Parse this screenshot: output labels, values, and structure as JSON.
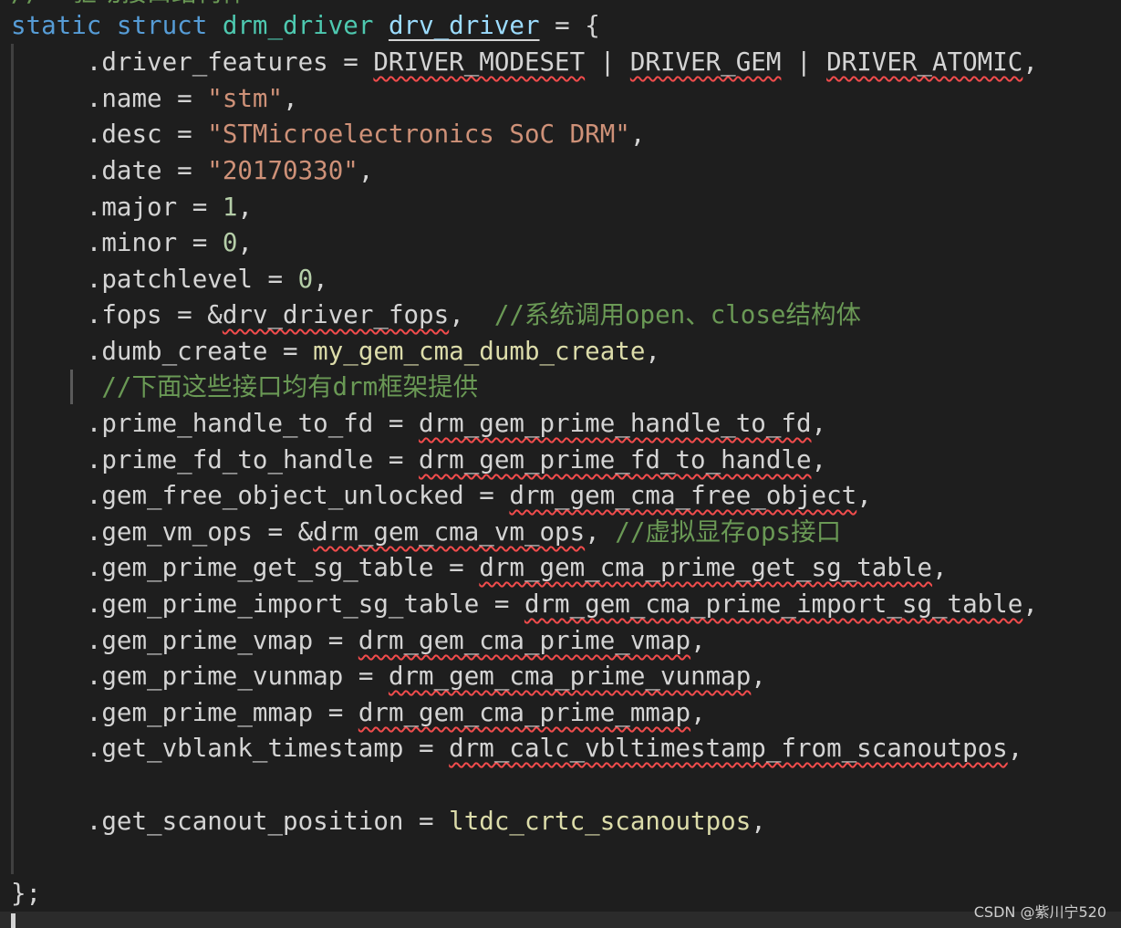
{
  "code": {
    "partial_top_comment": "//  驱动接口结构体",
    "l1": {
      "kw1": "static",
      "kw2": "struct",
      "type": "drm_driver",
      "name": "drv_driver",
      "rest": " = {"
    },
    "l2": {
      "field": ".driver_features",
      "eq": " = ",
      "m1": "DRIVER_MODESET",
      "sep1": " | ",
      "m2": "DRIVER_GEM",
      "sep2": " | ",
      "m3": "DRIVER_ATOMIC",
      "end": ","
    },
    "l3": {
      "field": ".name",
      "eq": " = ",
      "val": "\"stm\"",
      "end": ","
    },
    "l4": {
      "field": ".desc",
      "eq": " = ",
      "val": "\"STMicroelectronics SoC DRM\"",
      "end": ","
    },
    "l5": {
      "field": ".date",
      "eq": " = ",
      "val": "\"20170330\"",
      "end": ","
    },
    "l6": {
      "field": ".major",
      "eq": " = ",
      "val": "1",
      "end": ","
    },
    "l7": {
      "field": ".minor",
      "eq": " = ",
      "val": "0",
      "end": ","
    },
    "l8": {
      "field": ".patchlevel",
      "eq": " = ",
      "val": "0",
      "end": ","
    },
    "l9": {
      "field": ".fops",
      "eq": " = ",
      "amp": "&",
      "val": "drv_driver_fops",
      "end": ",  ",
      "comment": "//系统调用open、close结构体"
    },
    "l10": {
      "field": ".dumb_create",
      "eq": " = ",
      "val": "my_gem_cma_dumb_create",
      "end": ","
    },
    "l11": {
      "comment": "//下面这些接口均有drm框架提供"
    },
    "l12": {
      "field": ".prime_handle_to_fd",
      "eq": " = ",
      "val": "drm_gem_prime_handle_to_fd",
      "end": ","
    },
    "l13": {
      "field": ".prime_fd_to_handle",
      "eq": " = ",
      "val": "drm_gem_prime_fd_to_handle",
      "end": ","
    },
    "l14": {
      "field": ".gem_free_object_unlocked",
      "eq": " = ",
      "val": "drm_gem_cma_free_object",
      "end": ","
    },
    "l15": {
      "field": ".gem_vm_ops",
      "eq": " = ",
      "amp": "&",
      "val": "drm_gem_cma_vm_ops",
      "end": ", ",
      "comment": "//虚拟显存ops接口"
    },
    "l16": {
      "field": ".gem_prime_get_sg_table",
      "eq": " = ",
      "val": "drm_gem_cma_prime_get_sg_table",
      "end": ","
    },
    "l17": {
      "field": ".gem_prime_import_sg_table",
      "eq": " = ",
      "val": "drm_gem_cma_prime_import_sg_table",
      "end": ","
    },
    "l18": {
      "field": ".gem_prime_vmap",
      "eq": " = ",
      "val": "drm_gem_cma_prime_vmap",
      "end": ","
    },
    "l19": {
      "field": ".gem_prime_vunmap",
      "eq": " = ",
      "val": "drm_gem_cma_prime_vunmap",
      "end": ","
    },
    "l20": {
      "field": ".gem_prime_mmap",
      "eq": " = ",
      "val": "drm_gem_cma_prime_mmap",
      "end": ","
    },
    "l21": {
      "field": ".get_vblank_timestamp",
      "eq": " = ",
      "val": "drm_calc_vbltimestamp_from_scanoutpos",
      "end": ","
    },
    "l22": {
      "field": ".get_scanout_position",
      "eq": " = ",
      "val": "ltdc_crtc_scanoutpos",
      "end": ","
    },
    "l23": {
      "close": "};"
    }
  },
  "watermark": "CSDN @紫川宁520",
  "colors": {
    "background": "#1e1e1e",
    "keyword": "#569cd6",
    "type": "#4ec9b0",
    "function": "#dcdcaa",
    "string": "#ce9178",
    "number": "#b5cea8",
    "comment": "#6a9955",
    "squiggle": "#f14c4c"
  }
}
